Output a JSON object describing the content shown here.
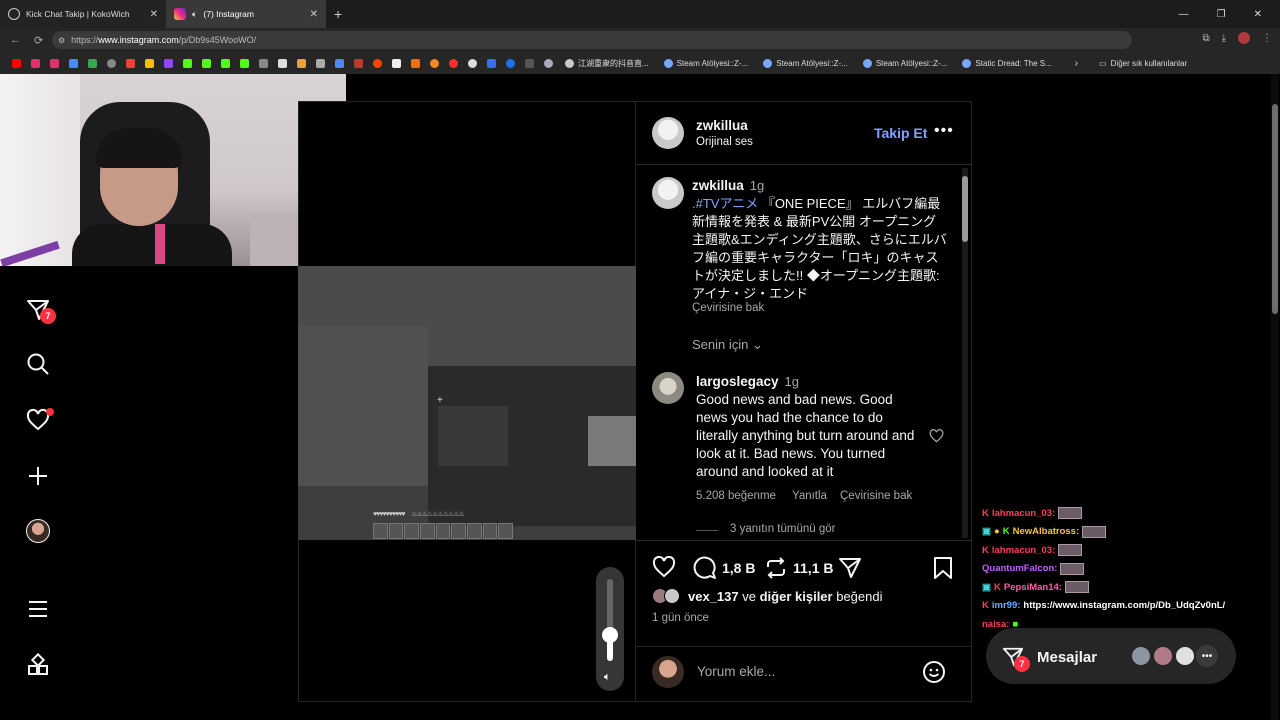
{
  "browser": {
    "tabs": [
      {
        "title": "Kick Chat Takip | KokoWich",
        "active": false
      },
      {
        "title": "(7) Instagram",
        "active": true
      }
    ],
    "url_prefix": "https://",
    "url_domain": "www.instagram.com",
    "url_path": "/p/Db9s45WooWO/",
    "bookmarks": [
      {
        "label": "江湖重衆的抖音直..."
      },
      {
        "label": "Steam Atölyesi::Z-..."
      },
      {
        "label": "Steam Atölyesi::Z-..."
      },
      {
        "label": "Steam Atölyesi::Z-..."
      },
      {
        "label": "Static Dread: The S..."
      }
    ],
    "other_bookmarks": "Diğer sık kullanılanlar"
  },
  "sidebar": {
    "notification_count": "7"
  },
  "post": {
    "author": "zwkillua",
    "audio": "Orijinal ses",
    "follow_label": "Takip Et",
    "caption_author": "zwkillua",
    "caption_time": "1g",
    "caption_tag": ".#TVアニメ",
    "caption_text": " 『ONE PIECE』 エルバフ編最新情報を発表 & 最新PV公開 オープニング主題歌&エンディング主題歌、さらにエルバフ編の重要キャラクター「ロキ」のキャストが決定しました!! ◆オープニング主題歌: アイナ・ジ・エンド",
    "translate": "Çevirisine bak",
    "for_you": "Senin için",
    "comment": {
      "author": "largoslegacy",
      "time": "1g",
      "text": "Good news and bad news. Good news you had the chance to do literally anything but turn around and look at it. Bad news. You turned around and looked at it",
      "likes": "5.208 beğenme",
      "reply": "Yanıtla",
      "translate": "Çevirisine bak",
      "view_replies": "3 yanıtın tümünü gör"
    },
    "comment_count": "1,8 B",
    "repost_count": "11,1 B",
    "liked_by_user": "vex_137",
    "liked_by_and": "ve",
    "liked_by_others": "diğer kişiler",
    "liked_by_suffix": "beğendi",
    "time_ago": "1 gün önce",
    "add_comment_placeholder": "Yorum ekle..."
  },
  "chat": [
    {
      "user": "lahmacun_03:",
      "color": "#ff3b5c",
      "text": ""
    },
    {
      "user": "NewAlbatross:",
      "color": "#f5c542",
      "text": ""
    },
    {
      "user": "lahmacun_03:",
      "color": "#ff3b5c",
      "text": ""
    },
    {
      "user": "QuantumFalcon:",
      "color": "#c95cff",
      "text": ""
    },
    {
      "user": "PepsiMan14:",
      "color": "#ff5ca8",
      "text": ""
    },
    {
      "user": "imr99:",
      "color": "#6ea8ff",
      "text": "https://www.instagram.com/p/Db_UdqZv0nL/"
    },
    {
      "user": "naisa:",
      "color": "#ff3b5c",
      "text": ""
    }
  ],
  "messages": {
    "label": "Mesajlar",
    "count": "7"
  }
}
